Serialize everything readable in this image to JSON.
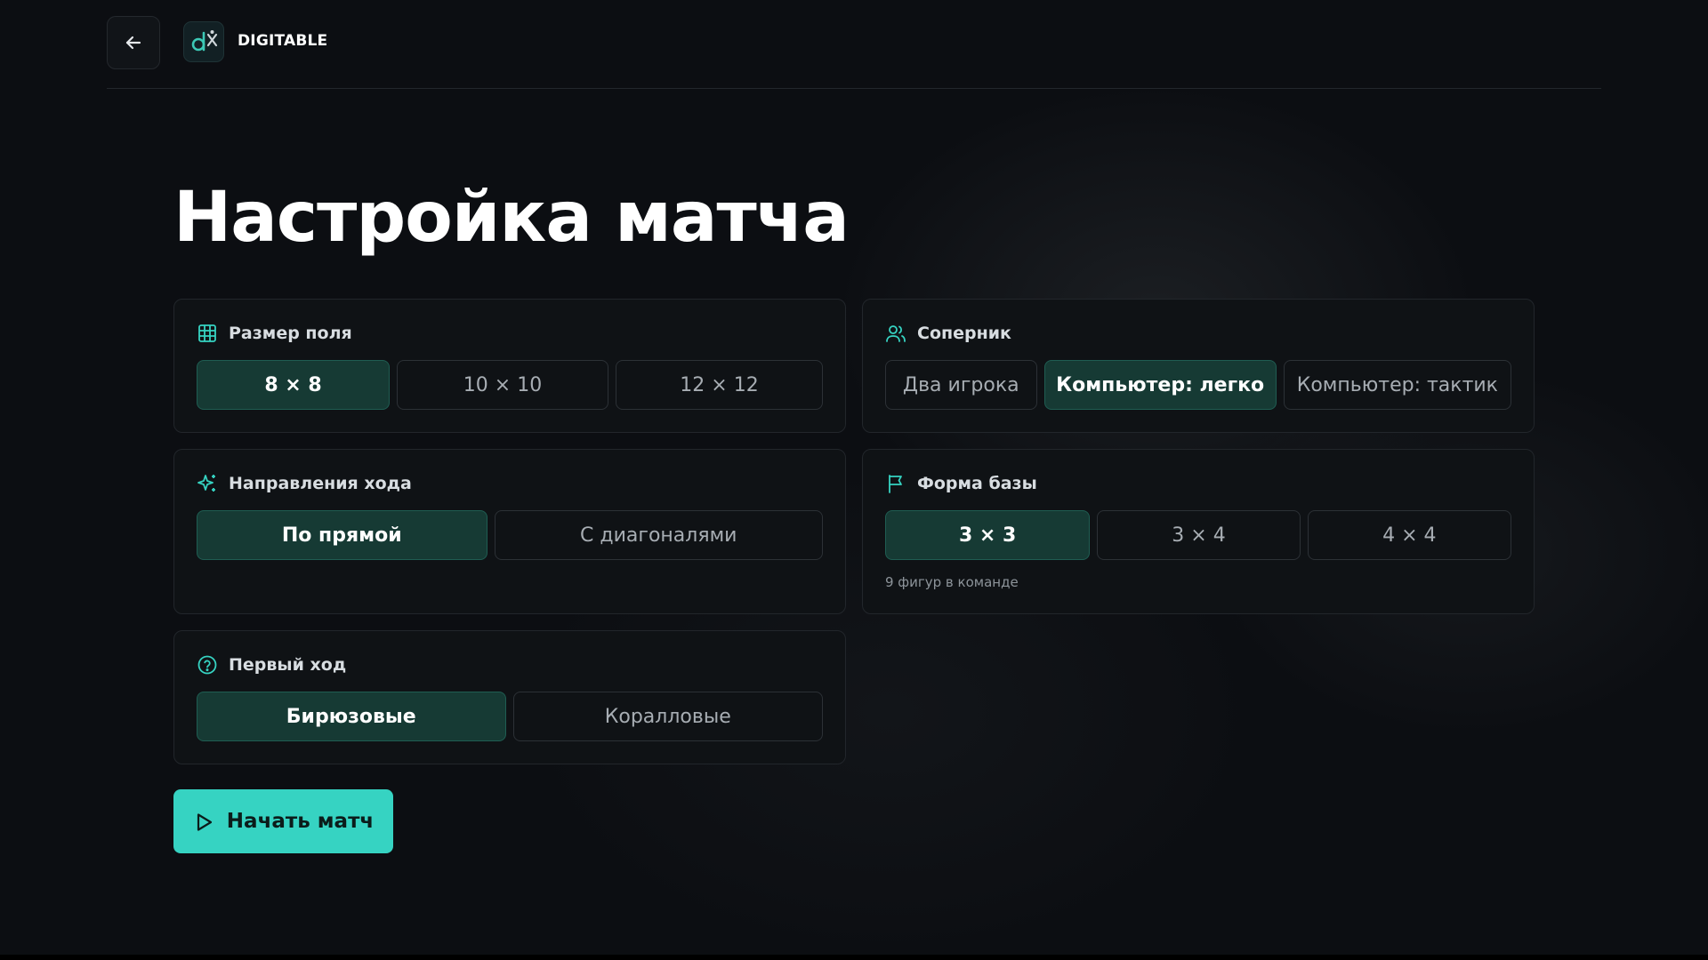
{
  "header": {
    "brand": "DIGITABLE",
    "back_icon": "arrow-left-icon",
    "logo_icon": "digitable-logo"
  },
  "page": {
    "title": "Настройка матча"
  },
  "colors": {
    "background": "#0c0e12",
    "accent": "#36d3c2",
    "active_option_bg": "#163a34",
    "active_option_border": "#1f5d52"
  },
  "board_size": {
    "title": "Размер поля",
    "icon": "grid-icon",
    "options": [
      {
        "label": "8 × 8",
        "active": true
      },
      {
        "label": "10 × 10",
        "active": false
      },
      {
        "label": "12 × 12",
        "active": false
      }
    ]
  },
  "opponent": {
    "title": "Соперник",
    "icon": "users-icon",
    "options": [
      {
        "label": "Два игрока",
        "active": false
      },
      {
        "label": "Компьютер: легко",
        "active": true
      },
      {
        "label": "Компьютер: тактик",
        "active": false
      }
    ]
  },
  "move_directions": {
    "title": "Направления хода",
    "icon": "sparkles-icon",
    "options": [
      {
        "label": "По прямой",
        "active": true
      },
      {
        "label": "С диагоналями",
        "active": false
      }
    ]
  },
  "base_shape": {
    "title": "Форма базы",
    "icon": "flag-icon",
    "options": [
      {
        "label": "3 × 3",
        "active": true
      },
      {
        "label": "3 × 4",
        "active": false
      },
      {
        "label": "4 × 4",
        "active": false
      }
    ],
    "hint": "9 фигур в команде"
  },
  "first_move": {
    "title": "Первый ход",
    "icon": "help-circle-icon",
    "options": [
      {
        "label": "Бирюзовые",
        "active": true
      },
      {
        "label": "Коралловые",
        "active": false
      }
    ]
  },
  "start": {
    "label": "Начать матч",
    "icon": "play-icon"
  }
}
